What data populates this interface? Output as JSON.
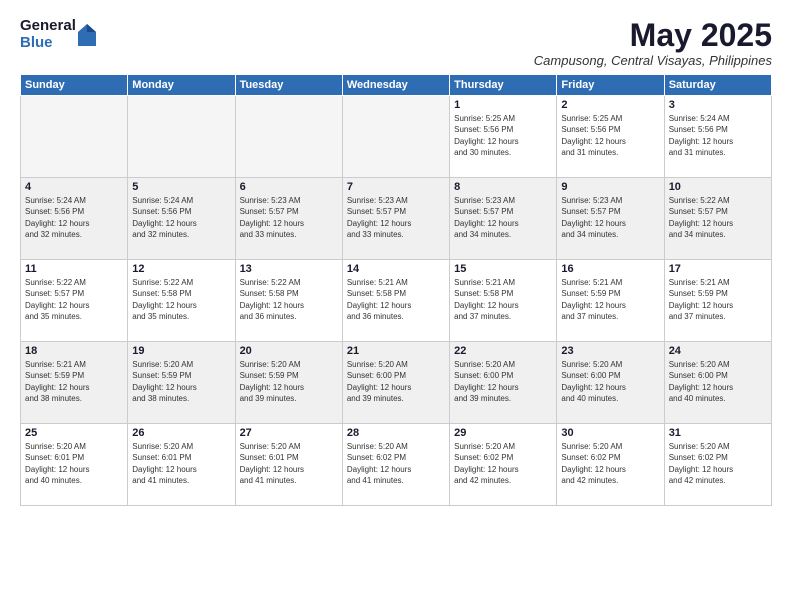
{
  "logo": {
    "general": "General",
    "blue": "Blue"
  },
  "header": {
    "month_year": "May 2025",
    "location": "Campusong, Central Visayas, Philippines"
  },
  "weekdays": [
    "Sunday",
    "Monday",
    "Tuesday",
    "Wednesday",
    "Thursday",
    "Friday",
    "Saturday"
  ],
  "weeks": [
    [
      {
        "day": "",
        "info": ""
      },
      {
        "day": "",
        "info": ""
      },
      {
        "day": "",
        "info": ""
      },
      {
        "day": "",
        "info": ""
      },
      {
        "day": "1",
        "info": "Sunrise: 5:25 AM\nSunset: 5:56 PM\nDaylight: 12 hours\nand 30 minutes."
      },
      {
        "day": "2",
        "info": "Sunrise: 5:25 AM\nSunset: 5:56 PM\nDaylight: 12 hours\nand 31 minutes."
      },
      {
        "day": "3",
        "info": "Sunrise: 5:24 AM\nSunset: 5:56 PM\nDaylight: 12 hours\nand 31 minutes."
      }
    ],
    [
      {
        "day": "4",
        "info": "Sunrise: 5:24 AM\nSunset: 5:56 PM\nDaylight: 12 hours\nand 32 minutes."
      },
      {
        "day": "5",
        "info": "Sunrise: 5:24 AM\nSunset: 5:56 PM\nDaylight: 12 hours\nand 32 minutes."
      },
      {
        "day": "6",
        "info": "Sunrise: 5:23 AM\nSunset: 5:57 PM\nDaylight: 12 hours\nand 33 minutes."
      },
      {
        "day": "7",
        "info": "Sunrise: 5:23 AM\nSunset: 5:57 PM\nDaylight: 12 hours\nand 33 minutes."
      },
      {
        "day": "8",
        "info": "Sunrise: 5:23 AM\nSunset: 5:57 PM\nDaylight: 12 hours\nand 34 minutes."
      },
      {
        "day": "9",
        "info": "Sunrise: 5:23 AM\nSunset: 5:57 PM\nDaylight: 12 hours\nand 34 minutes."
      },
      {
        "day": "10",
        "info": "Sunrise: 5:22 AM\nSunset: 5:57 PM\nDaylight: 12 hours\nand 34 minutes."
      }
    ],
    [
      {
        "day": "11",
        "info": "Sunrise: 5:22 AM\nSunset: 5:57 PM\nDaylight: 12 hours\nand 35 minutes."
      },
      {
        "day": "12",
        "info": "Sunrise: 5:22 AM\nSunset: 5:58 PM\nDaylight: 12 hours\nand 35 minutes."
      },
      {
        "day": "13",
        "info": "Sunrise: 5:22 AM\nSunset: 5:58 PM\nDaylight: 12 hours\nand 36 minutes."
      },
      {
        "day": "14",
        "info": "Sunrise: 5:21 AM\nSunset: 5:58 PM\nDaylight: 12 hours\nand 36 minutes."
      },
      {
        "day": "15",
        "info": "Sunrise: 5:21 AM\nSunset: 5:58 PM\nDaylight: 12 hours\nand 37 minutes."
      },
      {
        "day": "16",
        "info": "Sunrise: 5:21 AM\nSunset: 5:59 PM\nDaylight: 12 hours\nand 37 minutes."
      },
      {
        "day": "17",
        "info": "Sunrise: 5:21 AM\nSunset: 5:59 PM\nDaylight: 12 hours\nand 37 minutes."
      }
    ],
    [
      {
        "day": "18",
        "info": "Sunrise: 5:21 AM\nSunset: 5:59 PM\nDaylight: 12 hours\nand 38 minutes."
      },
      {
        "day": "19",
        "info": "Sunrise: 5:20 AM\nSunset: 5:59 PM\nDaylight: 12 hours\nand 38 minutes."
      },
      {
        "day": "20",
        "info": "Sunrise: 5:20 AM\nSunset: 5:59 PM\nDaylight: 12 hours\nand 39 minutes."
      },
      {
        "day": "21",
        "info": "Sunrise: 5:20 AM\nSunset: 6:00 PM\nDaylight: 12 hours\nand 39 minutes."
      },
      {
        "day": "22",
        "info": "Sunrise: 5:20 AM\nSunset: 6:00 PM\nDaylight: 12 hours\nand 39 minutes."
      },
      {
        "day": "23",
        "info": "Sunrise: 5:20 AM\nSunset: 6:00 PM\nDaylight: 12 hours\nand 40 minutes."
      },
      {
        "day": "24",
        "info": "Sunrise: 5:20 AM\nSunset: 6:00 PM\nDaylight: 12 hours\nand 40 minutes."
      }
    ],
    [
      {
        "day": "25",
        "info": "Sunrise: 5:20 AM\nSunset: 6:01 PM\nDaylight: 12 hours\nand 40 minutes."
      },
      {
        "day": "26",
        "info": "Sunrise: 5:20 AM\nSunset: 6:01 PM\nDaylight: 12 hours\nand 41 minutes."
      },
      {
        "day": "27",
        "info": "Sunrise: 5:20 AM\nSunset: 6:01 PM\nDaylight: 12 hours\nand 41 minutes."
      },
      {
        "day": "28",
        "info": "Sunrise: 5:20 AM\nSunset: 6:02 PM\nDaylight: 12 hours\nand 41 minutes."
      },
      {
        "day": "29",
        "info": "Sunrise: 5:20 AM\nSunset: 6:02 PM\nDaylight: 12 hours\nand 42 minutes."
      },
      {
        "day": "30",
        "info": "Sunrise: 5:20 AM\nSunset: 6:02 PM\nDaylight: 12 hours\nand 42 minutes."
      },
      {
        "day": "31",
        "info": "Sunrise: 5:20 AM\nSunset: 6:02 PM\nDaylight: 12 hours\nand 42 minutes."
      }
    ]
  ]
}
